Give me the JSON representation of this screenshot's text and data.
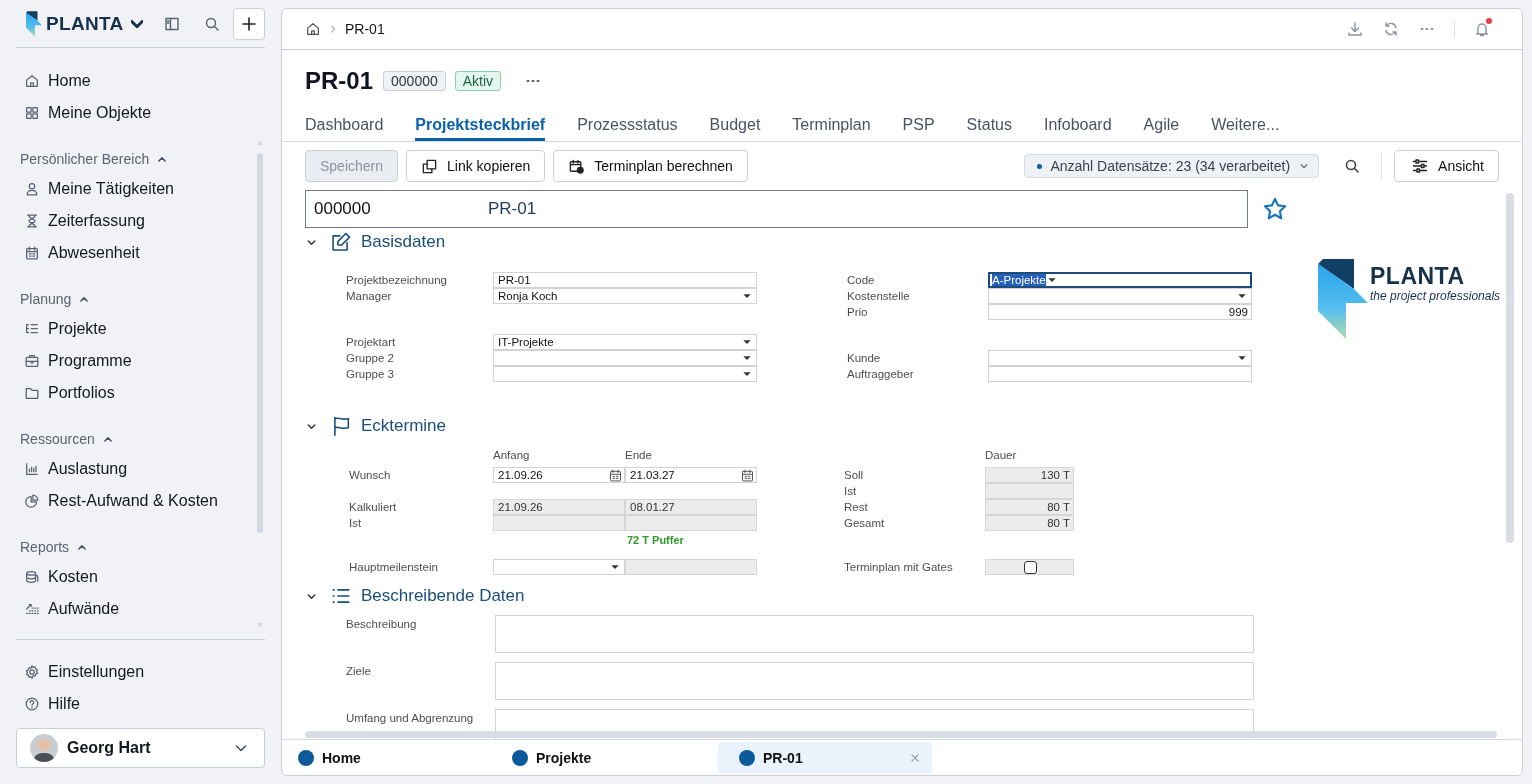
{
  "sidebar": {
    "brand": "PLANTA",
    "top_items": [
      {
        "label": "Home",
        "selected": false
      },
      {
        "label": "Meine Objekte",
        "selected": false
      }
    ],
    "groups": [
      {
        "label": "Persönlicher Bereich",
        "expanded": true,
        "items": [
          {
            "label": "Meine Tätigkeiten",
            "selected": false
          },
          {
            "label": "Zeiterfassung",
            "selected": false
          },
          {
            "label": "Abwesenheit",
            "selected": false
          }
        ]
      },
      {
        "label": "Planung",
        "expanded": true,
        "items": [
          {
            "label": "Projekte",
            "selected": false
          },
          {
            "label": "Programme",
            "selected": false
          },
          {
            "label": "Portfolios",
            "selected": false
          }
        ]
      },
      {
        "label": "Ressourcen",
        "expanded": true,
        "items": [
          {
            "label": "Auslastung",
            "selected": false
          },
          {
            "label": "Rest-Aufwand & Kosten",
            "selected": false
          }
        ]
      },
      {
        "label": "Reports",
        "expanded": true,
        "items": [
          {
            "label": "Kosten",
            "selected": false
          },
          {
            "label": "Aufwände",
            "selected": false
          }
        ]
      }
    ],
    "bottom_items": [
      {
        "label": "Einstellungen",
        "selected": false
      },
      {
        "label": "Hilfe",
        "selected": false
      }
    ],
    "user": {
      "name": "Georg Hart"
    }
  },
  "breadcrumb": {
    "items": [
      "PR-01"
    ]
  },
  "notifications": {
    "unread": true
  },
  "project": {
    "title": "PR-01",
    "number": "000000",
    "status": "Aktiv"
  },
  "tabs": [
    {
      "label": "Dashboard",
      "selected": false
    },
    {
      "label": "Projektsteckbrief",
      "selected": true
    },
    {
      "label": "Prozessstatus",
      "selected": false
    },
    {
      "label": "Budget",
      "selected": false
    },
    {
      "label": "Terminplan",
      "selected": false
    },
    {
      "label": "PSP",
      "selected": false
    },
    {
      "label": "Status",
      "selected": false
    },
    {
      "label": "Infoboard",
      "selected": false
    },
    {
      "label": "Agile",
      "selected": false
    },
    {
      "label": "Weitere...",
      "selected": false
    }
  ],
  "toolbar": {
    "buttons": [
      {
        "label": "Speichern",
        "disabled": true
      },
      {
        "label": "Link kopieren",
        "disabled": false
      },
      {
        "label": "Terminplan berechnen",
        "disabled": false
      }
    ],
    "record_count": "Anzahl Datensätze: 23 (34 verarbeitet)",
    "view_button": "Ansicht"
  },
  "form": {
    "header": {
      "number": "000000",
      "name": "PR-01",
      "favorite": false
    },
    "basisdaten": {
      "title": "Basisdaten",
      "expanded": true,
      "groups": [
        [
          {
            "left": {
              "label": "Projektbezeichnung",
              "kind": "text",
              "value": "PR-01",
              "focused": false
            },
            "right": {
              "label": "Code",
              "kind": "select",
              "value": "A-Projekte",
              "focused": true
            }
          },
          {
            "left": {
              "label": "Manager",
              "kind": "select",
              "value": "Ronja Koch",
              "focused": false
            },
            "right": {
              "label": "Kostenstelle",
              "kind": "select",
              "focused": false
            }
          },
          {
            "right": {
              "label": "Prio",
              "kind": "number",
              "value": "999",
              "focused": false
            }
          }
        ],
        [
          {
            "left": {
              "label": "Projektart",
              "kind": "select",
              "value": "IT-Projekte",
              "focused": false
            }
          },
          {
            "left": {
              "label": "Gruppe 2",
              "kind": "select",
              "focused": false
            },
            "right": {
              "label": "Kunde",
              "kind": "select",
              "focused": false
            }
          },
          {
            "left": {
              "label": "Gruppe 3",
              "kind": "select",
              "focused": false
            },
            "right": {
              "label": "Auftraggeber",
              "kind": "text",
              "focused": false
            }
          }
        ]
      ]
    },
    "logo": {
      "name": "PLANTA",
      "tagline": "the project professionals"
    },
    "ecktermine": {
      "title": "Ecktermine",
      "expanded": true,
      "left_columns": [
        "Anfang",
        "Ende"
      ],
      "right_columns": [
        "Dauer"
      ],
      "rows": [
        {
          "left": {
            "label": "Wunsch",
            "cells": [
              {
                "kind": "date",
                "value": "21.09.26"
              },
              {
                "kind": "date",
                "value": "21.03.27"
              }
            ]
          },
          "right": {
            "label": "Soll",
            "cells": [
              {
                "kind": "readonly",
                "value": "130 T"
              }
            ]
          }
        },
        {
          "right": {
            "label": "Ist",
            "cells": [
              {
                "kind": "readonly"
              }
            ]
          }
        },
        {
          "left": {
            "label": "Kalkuliert",
            "cells": [
              {
                "kind": "readonly",
                "value": "21.09.26"
              },
              {
                "kind": "readonly",
                "value": "08.01.27"
              }
            ]
          },
          "right": {
            "label": "Rest",
            "cells": [
              {
                "kind": "readonly",
                "value": "80 T"
              }
            ]
          }
        },
        {
          "left": {
            "label": "Ist",
            "cells": [
              {
                "kind": "readonly"
              },
              {
                "kind": "readonly"
              }
            ]
          },
          "right": {
            "label": "Gesamt",
            "cells": [
              {
                "kind": "readonly",
                "value": "80 T"
              }
            ]
          }
        }
      ],
      "buffer": "72 T Puffer",
      "milestone_rows": [
        {
          "left": {
            "label": "Hauptmeilenstein",
            "cells": [
              {
                "kind": "select"
              },
              {
                "kind": "readonly"
              }
            ]
          },
          "right": {
            "label": "Terminplan mit Gates",
            "cells": [
              {
                "kind": "checkbox",
                "checked": false
              }
            ]
          }
        }
      ]
    },
    "beschreibende_daten": {
      "title": "Beschreibende Daten",
      "expanded": true,
      "fields": [
        {
          "label": "Beschreibung"
        },
        {
          "label": "Ziele"
        },
        {
          "label": "Umfang und Abgrenzung"
        }
      ]
    }
  },
  "open_tabs": [
    {
      "label": "Home",
      "selected": false
    },
    {
      "label": "Projekte",
      "selected": false
    },
    {
      "label": "PR-01",
      "selected": true
    }
  ]
}
